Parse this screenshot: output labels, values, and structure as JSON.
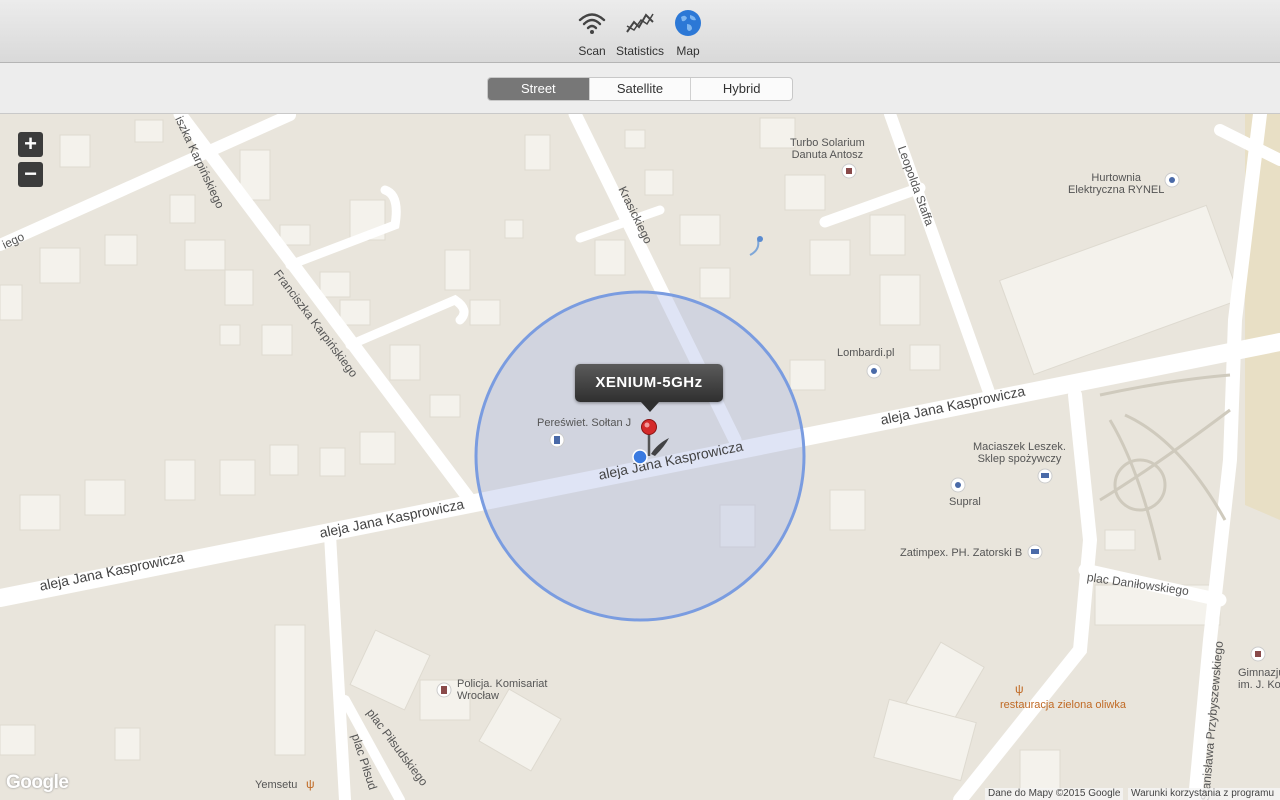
{
  "toolbar": {
    "items": [
      {
        "label": "Scan",
        "icon": "wifi-icon"
      },
      {
        "label": "Statistics",
        "icon": "chart-line-icon"
      },
      {
        "label": "Map",
        "icon": "globe-icon"
      }
    ]
  },
  "map_types": {
    "selected": "Street",
    "options": [
      "Street",
      "Satellite",
      "Hybrid"
    ]
  },
  "map": {
    "zoom_in": "+",
    "zoom_out": "−",
    "network_callout": "XENIUM-5GHz",
    "roads": {
      "kasprowicza_1": "aleja Jana Kasprowicza",
      "kasprowicza_2": "aleja Jana Kasprowicza",
      "kasprowicza_3": "aleja Jana Kasprowicza",
      "kasprowicza_4": "aleja Jana Kasprowicza",
      "karpinskiego_1": "Franciszka Karpińskiego",
      "karpinskiego_2": "iszka Karpińskiego",
      "krasickiego": "Krasickiego",
      "staffa": "Leopolda Staffa",
      "danilowskiego": "plac Daniłowskiego",
      "przybyszewskiego": "Stanisława Przybyszewskiego",
      "pilsudskiego_1": "plac Piłsudskiego",
      "pilsudskiego_2": "plac Piłsud",
      "iego": "iego"
    },
    "pois": {
      "turbo": [
        "Turbo Solarium",
        "Danuta Antosz"
      ],
      "hurtownia": [
        "Hurtownia",
        "Elektryczna RYNEL"
      ],
      "lombardi": "Lombardi.pl",
      "pereswiet": "Pereświet. Sołtan J",
      "maciaszek": [
        "Maciaszek Leszek.",
        "Sklep spożywczy"
      ],
      "supral": "Supral",
      "zatimpex": "Zatimpex. PH. Zatorski B",
      "policja": [
        "Policja. Komisariat",
        "Wrocław"
      ],
      "restauracja": "restauracja zielona oliwka",
      "gimnazjum": [
        "Gimnazju",
        "im. J. Ko"
      ],
      "yemsetu": "Yemsetu"
    },
    "google_logo": "Google",
    "attribution_data": "Dane do Mapy ©2015 Google",
    "attribution_terms": "Warunki korzystania z programu"
  },
  "colors": {
    "accent_circle": "#7a9ce0",
    "road": "#ffffff",
    "land": "#e9e5dc",
    "building": "#f4f2ec",
    "callout_bg": "#3a3a3a",
    "segment_active": "#777777"
  }
}
